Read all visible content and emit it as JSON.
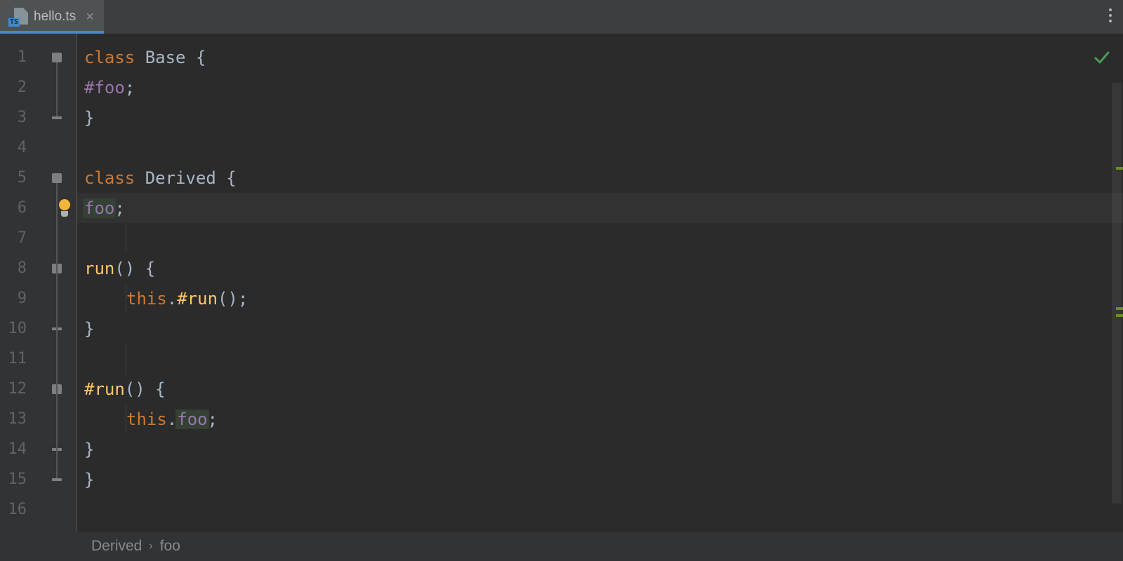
{
  "tab": {
    "file_type_badge": "TS",
    "filename": "hello.ts"
  },
  "editor": {
    "current_line": 6,
    "lines": [
      {
        "num": 1,
        "tokens": [
          {
            "t": "class ",
            "c": "keyword"
          },
          {
            "t": "Base ",
            "c": "classname"
          },
          {
            "t": "{",
            "c": "punct"
          }
        ],
        "fold": "open",
        "fold_top": true
      },
      {
        "num": 2,
        "tokens": [
          {
            "t": "    ",
            "c": "indent1"
          },
          {
            "t": "#foo",
            "c": "private"
          },
          {
            "t": ";",
            "c": "punct"
          }
        ]
      },
      {
        "num": 3,
        "tokens": [
          {
            "t": "}",
            "c": "punct"
          }
        ],
        "fold": "close"
      },
      {
        "num": 4,
        "tokens": []
      },
      {
        "num": 5,
        "tokens": [
          {
            "t": "class ",
            "c": "keyword"
          },
          {
            "t": "Derived ",
            "c": "classname"
          },
          {
            "t": "{",
            "c": "punct"
          }
        ],
        "fold": "open",
        "fold_top": true
      },
      {
        "num": 6,
        "tokens": [
          {
            "t": "    ",
            "c": "indent1"
          },
          {
            "t": "foo",
            "c": "prop",
            "hl": true
          },
          {
            "t": ";",
            "c": "punct"
          }
        ],
        "highlighted": true,
        "bulb": true
      },
      {
        "num": 7,
        "tokens": [
          {
            "t": "",
            "c": "indent1g"
          }
        ]
      },
      {
        "num": 8,
        "tokens": [
          {
            "t": "    ",
            "c": "indent1"
          },
          {
            "t": "run",
            "c": "method"
          },
          {
            "t": "() {",
            "c": "punct"
          }
        ],
        "fold": "open"
      },
      {
        "num": 9,
        "tokens": [
          {
            "t": "        ",
            "c": "indent2"
          },
          {
            "t": "this",
            "c": "this"
          },
          {
            "t": ".",
            "c": "punct"
          },
          {
            "t": "#run",
            "c": "method"
          },
          {
            "t": "();",
            "c": "punct"
          }
        ]
      },
      {
        "num": 10,
        "tokens": [
          {
            "t": "    ",
            "c": "indent1"
          },
          {
            "t": "}",
            "c": "punct"
          }
        ],
        "fold": "close"
      },
      {
        "num": 11,
        "tokens": [
          {
            "t": "",
            "c": "indent1g"
          }
        ]
      },
      {
        "num": 12,
        "tokens": [
          {
            "t": "    ",
            "c": "indent1"
          },
          {
            "t": "#run",
            "c": "method"
          },
          {
            "t": "() {",
            "c": "punct"
          }
        ],
        "fold": "open"
      },
      {
        "num": 13,
        "tokens": [
          {
            "t": "        ",
            "c": "indent2"
          },
          {
            "t": "this",
            "c": "this"
          },
          {
            "t": ".",
            "c": "punct"
          },
          {
            "t": "foo",
            "c": "prop",
            "hl": true
          },
          {
            "t": ";",
            "c": "punct"
          }
        ]
      },
      {
        "num": 14,
        "tokens": [
          {
            "t": "    ",
            "c": "indent1"
          },
          {
            "t": "}",
            "c": "punct"
          }
        ],
        "fold": "close"
      },
      {
        "num": 15,
        "tokens": [
          {
            "t": "}",
            "c": "punct"
          }
        ],
        "fold": "close"
      },
      {
        "num": 16,
        "tokens": []
      }
    ],
    "inspection_status": "no-problems"
  },
  "markers": [
    190,
    390,
    400
  ],
  "breadcrumb": {
    "items": [
      "Derived",
      "foo"
    ]
  },
  "colors": {
    "keyword": "#CC7832",
    "classname": "#A9B7C6",
    "private": "#9876AA",
    "method": "#FFC66D",
    "background": "#2B2B2B",
    "gutter": "#313335",
    "highlight_bg": "#323232",
    "identifier_hl": "#344134"
  }
}
